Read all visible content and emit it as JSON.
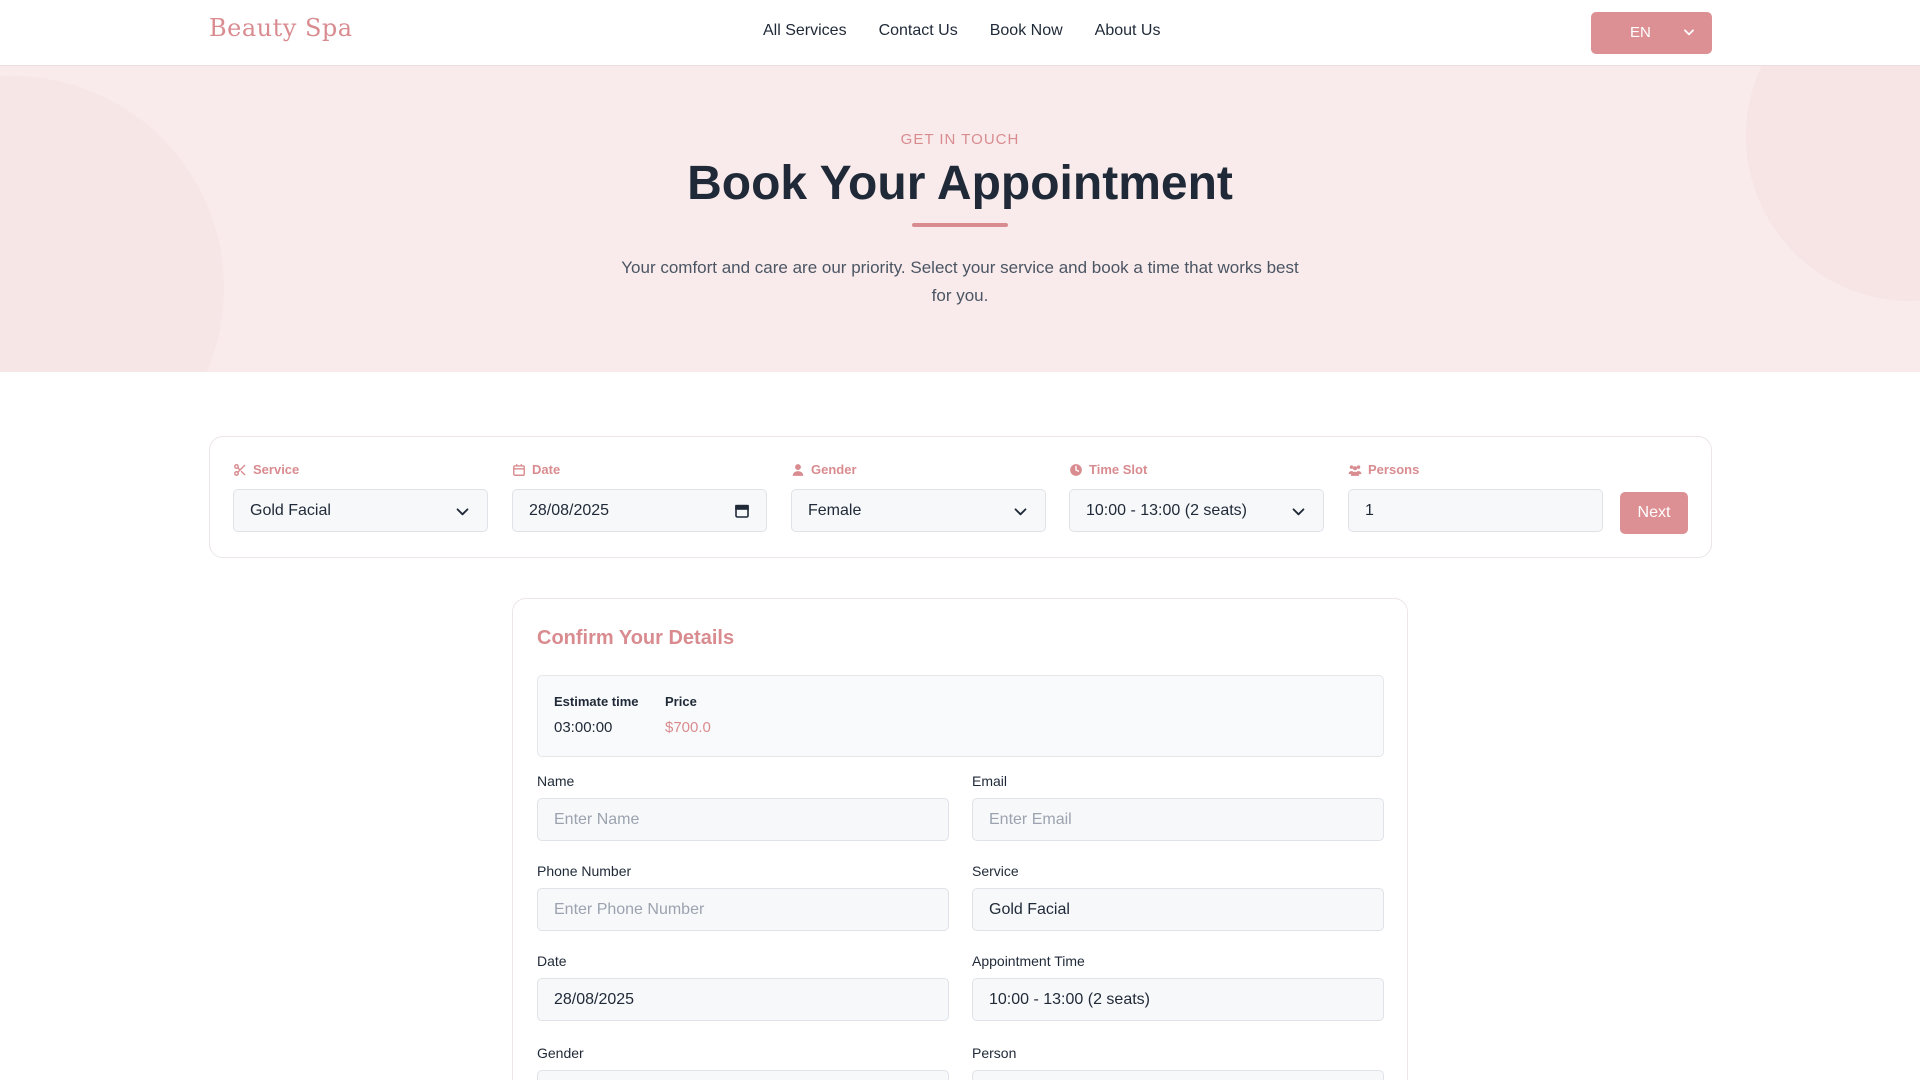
{
  "header": {
    "logo": "Beauty Spa",
    "nav": [
      "All Services",
      "Contact Us",
      "Book Now",
      "About Us"
    ],
    "language": "EN"
  },
  "hero": {
    "eyebrow": "GET IN TOUCH",
    "title": "Book Your Appointment",
    "subtitle": "Your comfort and care are our priority. Select your service and book a time that works best for you."
  },
  "booking_bar": {
    "service": {
      "label": "Service",
      "value": "Gold Facial",
      "icon": "scissors-icon"
    },
    "date": {
      "label": "Date",
      "value": "28/08/2025",
      "icon": "calendar-icon"
    },
    "gender": {
      "label": "Gender",
      "value": "Female",
      "icon": "user-icon"
    },
    "time_slot": {
      "label": "Time Slot",
      "value": "10:00 - 13:00 (2 seats)",
      "icon": "clock-icon"
    },
    "persons": {
      "label": "Persons",
      "value": "1",
      "icon": "users-icon"
    },
    "next_label": "Next"
  },
  "confirm": {
    "title": "Confirm Your Details",
    "estimate_label": "Estimate time",
    "estimate_value": "03:00:00",
    "price_label": "Price",
    "price_value": "$700.0",
    "fields": {
      "name": {
        "label": "Name",
        "placeholder": "Enter Name"
      },
      "email": {
        "label": "Email",
        "placeholder": "Enter Email"
      },
      "phone": {
        "label": "Phone Number",
        "placeholder": "Enter Phone Number"
      },
      "service": {
        "label": "Service",
        "value": "Gold Facial"
      },
      "date": {
        "label": "Date",
        "value": "28/08/2025"
      },
      "appointment_time": {
        "label": "Appointment Time",
        "value": "10:00 - 13:00 (2 seats)"
      },
      "gender": {
        "label": "Gender"
      },
      "person": {
        "label": "Person"
      }
    }
  },
  "colors": {
    "accent": "#dd9094",
    "hero_bg": "#f9ebeb",
    "text": "#1f2937"
  }
}
